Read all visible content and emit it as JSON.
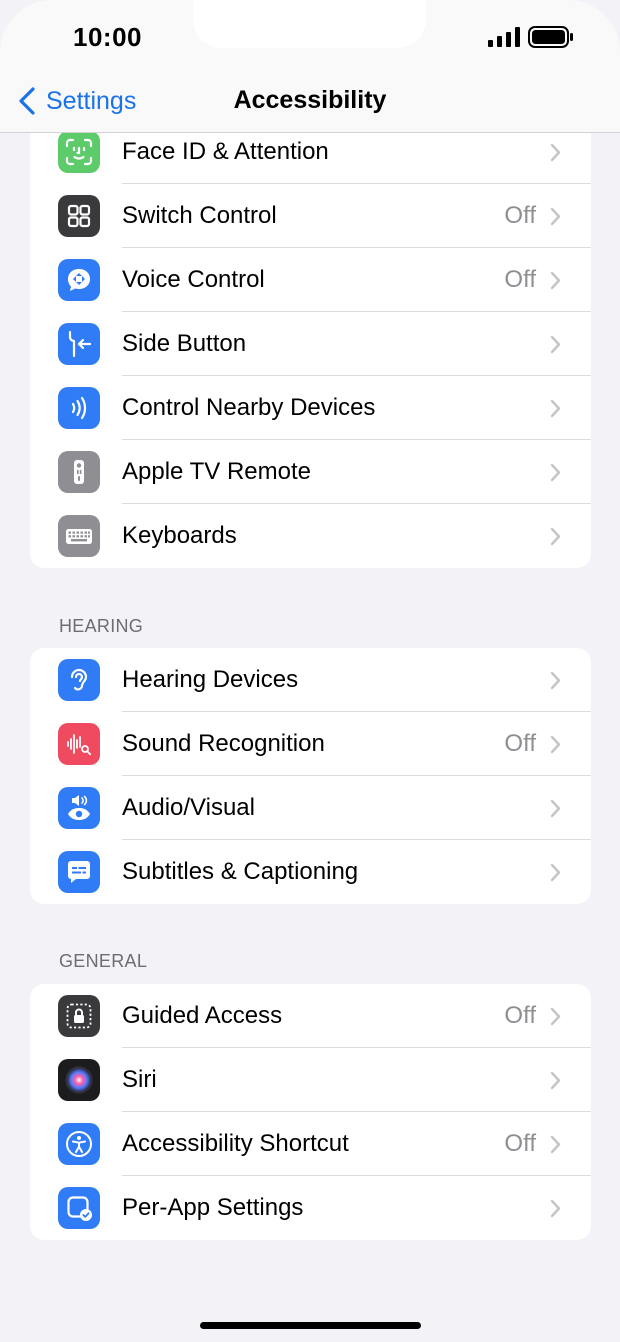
{
  "status_bar": {
    "time": "10:00"
  },
  "nav": {
    "back_label": "Settings",
    "title": "Accessibility"
  },
  "colors": {
    "accent": "#1a73e8",
    "background": "#f2f2f7"
  },
  "groups": [
    {
      "header": "",
      "rows": [
        {
          "label": "Face ID & Attention",
          "value": "",
          "icon": "face-id-icon",
          "icon_color": "#5ecb6b"
        },
        {
          "label": "Switch Control",
          "value": "Off",
          "icon": "switch-control-icon",
          "icon_color": "#3a3a3c"
        },
        {
          "label": "Voice Control",
          "value": "Off",
          "icon": "voice-control-icon",
          "icon_color": "#2f7cf6"
        },
        {
          "label": "Side Button",
          "value": "",
          "icon": "side-button-icon",
          "icon_color": "#2f7cf6"
        },
        {
          "label": "Control Nearby Devices",
          "value": "",
          "icon": "nearby-devices-icon",
          "icon_color": "#2f7cf6"
        },
        {
          "label": "Apple TV Remote",
          "value": "",
          "icon": "tv-remote-icon",
          "icon_color": "#8e8e93"
        },
        {
          "label": "Keyboards",
          "value": "",
          "icon": "keyboard-icon",
          "icon_color": "#8e8e93"
        }
      ]
    },
    {
      "header": "HEARING",
      "rows": [
        {
          "label": "Hearing Devices",
          "value": "",
          "icon": "ear-icon",
          "icon_color": "#2f7cf6"
        },
        {
          "label": "Sound Recognition",
          "value": "Off",
          "icon": "sound-recognition-icon",
          "icon_color": "#ef4a5f"
        },
        {
          "label": "Audio/Visual",
          "value": "",
          "icon": "audio-visual-icon",
          "icon_color": "#2f7cf6"
        },
        {
          "label": "Subtitles & Captioning",
          "value": "",
          "icon": "subtitles-icon",
          "icon_color": "#2f7cf6"
        }
      ]
    },
    {
      "header": "GENERAL",
      "rows": [
        {
          "label": "Guided Access",
          "value": "Off",
          "icon": "guided-access-icon",
          "icon_color": "#3a3a3c"
        },
        {
          "label": "Siri",
          "value": "",
          "icon": "siri-icon",
          "icon_color": "#1c1c1e"
        },
        {
          "label": "Accessibility Shortcut",
          "value": "Off",
          "icon": "accessibility-shortcut-icon",
          "icon_color": "#2f7cf6"
        },
        {
          "label": "Per-App Settings",
          "value": "",
          "icon": "per-app-settings-icon",
          "icon_color": "#2f7cf6"
        }
      ]
    }
  ]
}
